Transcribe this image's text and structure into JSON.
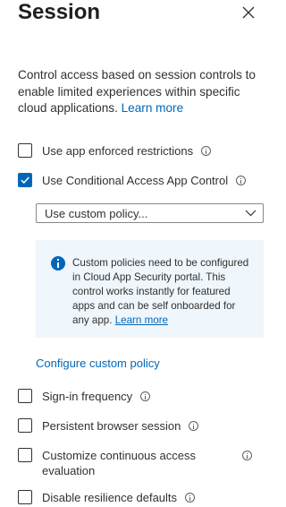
{
  "panel": {
    "title": "Session",
    "description": "Control access based on session controls to enable limited experiences within specific cloud applications.",
    "learn_more": "Learn more"
  },
  "controls": {
    "app_enforced": {
      "label": "Use app enforced restrictions",
      "checked": false
    },
    "cas_app_control": {
      "label": "Use Conditional Access App Control",
      "checked": true
    },
    "policy_select": {
      "value": "Use custom policy..."
    },
    "info_box": {
      "text": "Custom policies need to be configured in Cloud App Security portal. This control works instantly for featured apps and can be self onboarded for any app.",
      "learn_more": "Learn more"
    },
    "configure_link": "Configure custom policy",
    "sign_in_frequency": {
      "label": "Sign-in frequency",
      "checked": false
    },
    "persistent_browser": {
      "label": "Persistent browser session",
      "checked": false
    },
    "continuous_access": {
      "label": "Customize continuous access evaluation",
      "checked": false
    },
    "disable_resilience": {
      "label": "Disable resilience defaults",
      "checked": false
    }
  },
  "colors": {
    "accent": "#0067b8",
    "info_background": "#eff6fc",
    "text": "#323130"
  }
}
